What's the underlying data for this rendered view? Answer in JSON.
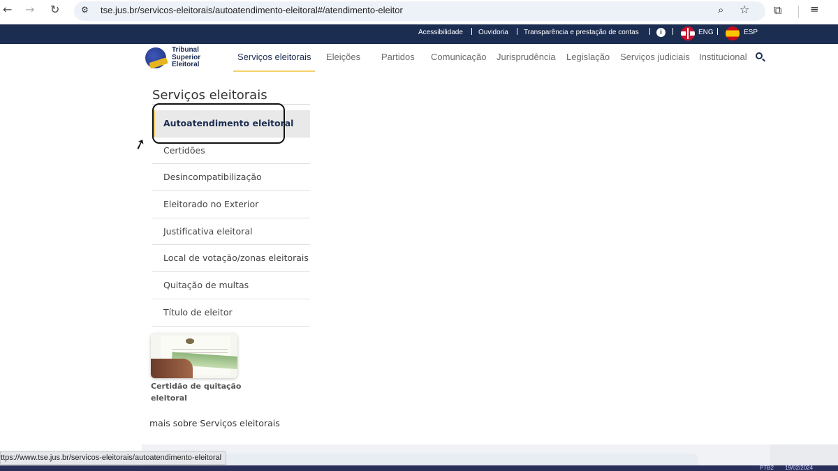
{
  "browser": {
    "url": "tse.jus.br/servicos-eleitorais/autoatendimento-eleitoral#/atendimento-eleitor",
    "status_url": "ttps://www.tse.jus.br/servicos-eleitorais/autoatendimento-eleitoral"
  },
  "topbar": {
    "links": [
      "Acessibilidade",
      "Ouvidoria",
      "Transparência e prestação de contas"
    ],
    "lang_eng": "ENG",
    "lang_esp": "ESP"
  },
  "logo": {
    "line1": "Tribunal",
    "line2": "Superior",
    "line3": "Eleitoral"
  },
  "nav": {
    "items": [
      "Serviços eleitorais",
      "Eleições",
      "Partidos",
      "Comunicação",
      "Jurisprudência",
      "Legislação",
      "Serviços judiciais",
      "Institucional"
    ]
  },
  "sidemenu": {
    "title": "Serviços eleitorais",
    "items": [
      "Autoatendimento eleitoral",
      "Certidões",
      "Desincompatibilização",
      "Eleitorado no Exterior",
      "Justificativa eleitoral",
      "Local de votação/zonas eleitorais",
      "Quitação de multas",
      "Título de eleitor"
    ]
  },
  "card": {
    "caption": "Certidão de quitação eleitoral"
  },
  "more_link": "mais sobre Serviços eleitorais",
  "taskbar": {
    "lang": "PTB2",
    "date": "19/02/2024"
  },
  "colors": {
    "navy": "#1c2d52",
    "accent_yellow": "#f1d26a"
  }
}
